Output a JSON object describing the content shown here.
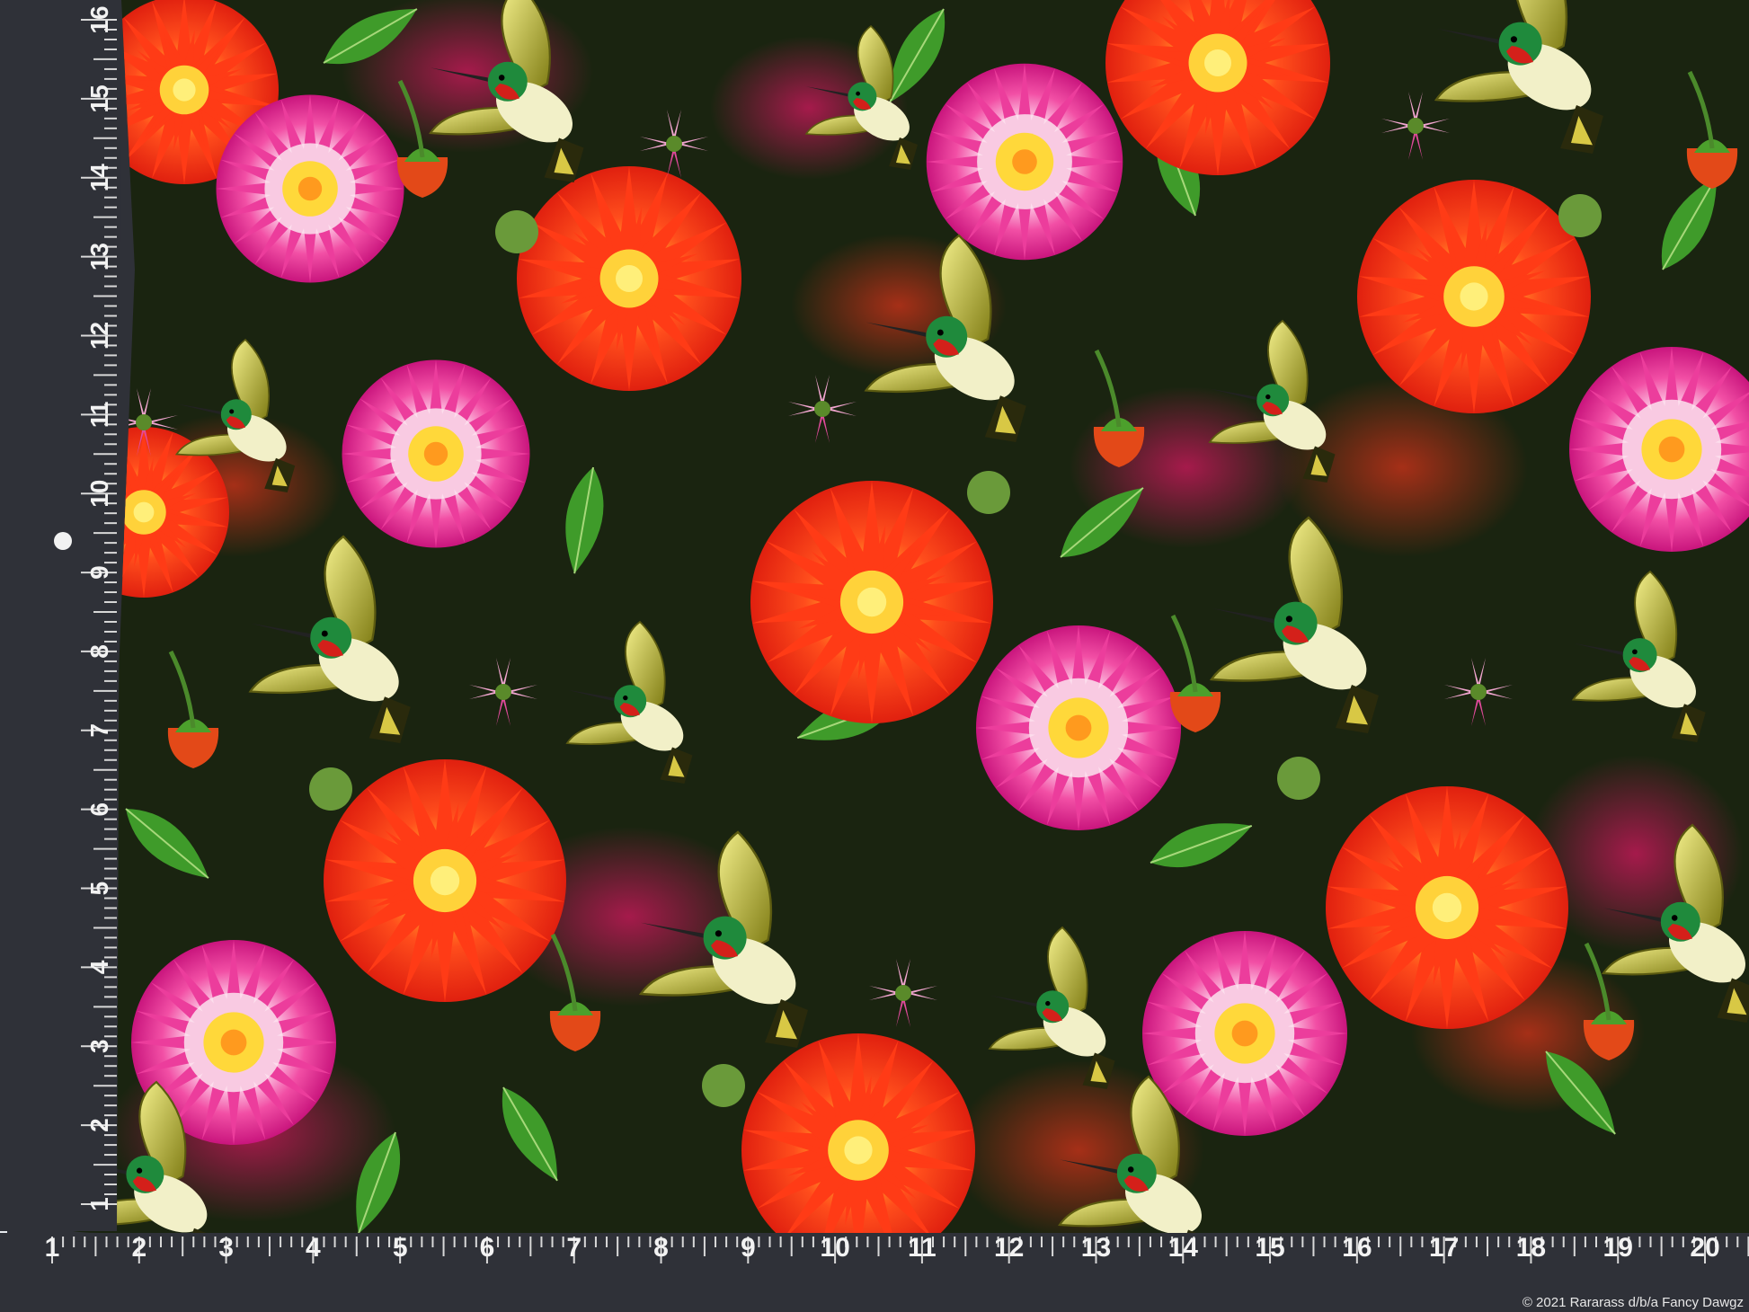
{
  "ruler": {
    "vertical_labels": [
      "16",
      "15",
      "14",
      "13",
      "12",
      "11",
      "10",
      "9",
      "8",
      "7",
      "6",
      "5",
      "4",
      "3",
      "2",
      "1"
    ],
    "horizontal_labels": [
      "1",
      "2",
      "3",
      "4",
      "5",
      "6",
      "7",
      "8",
      "9",
      "10",
      "11",
      "12",
      "13",
      "14",
      "15",
      "16",
      "17",
      "18",
      "19",
      "20"
    ],
    "color": "#2f3138"
  },
  "fabric": {
    "motifs": [
      "dahlia",
      "hummingbird",
      "bud"
    ],
    "colors": {
      "background": "#1a2410",
      "orange": "#ff3a14",
      "pink": "#ee3f9e",
      "leaf": "#3f9b2a"
    }
  },
  "copyright": "© 2021 Rararass d/b/a Fancy Dawgz"
}
